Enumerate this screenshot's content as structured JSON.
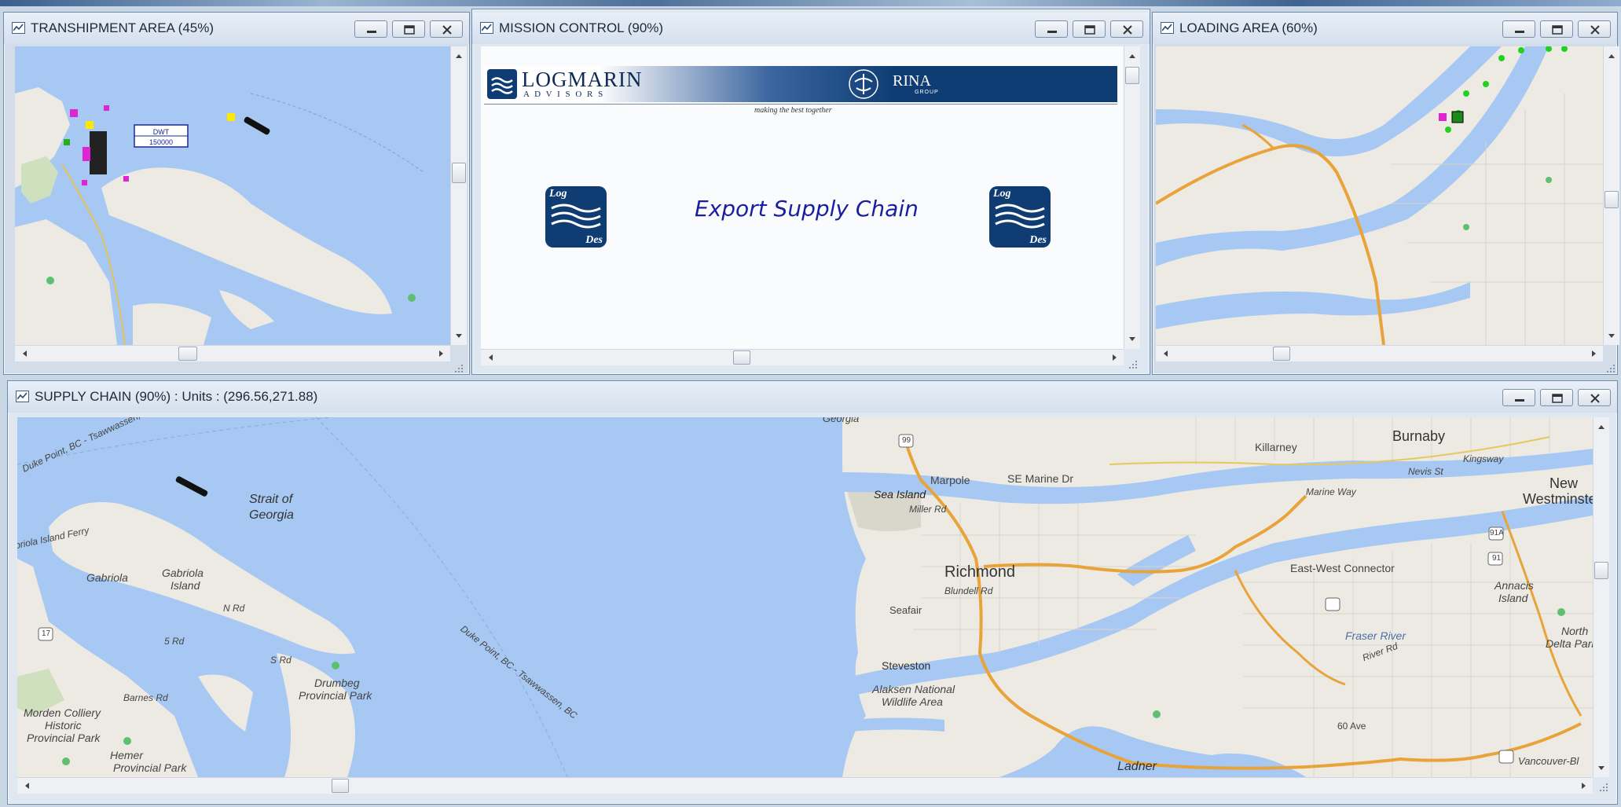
{
  "windows": {
    "transhipment": {
      "title": "TRANSHIPMENT AREA (45%)",
      "dwt_label": "DWT",
      "dwt_value": "150000"
    },
    "mission": {
      "title": "MISSION CONTROL (90%)",
      "heading": "Export Supply Chain"
    },
    "loading": {
      "title": "LOADING AREA (60%)"
    },
    "supply": {
      "title": "SUPPLY CHAIN (90%)  : Units : (296.56,271.88)"
    }
  },
  "mission_banner": {
    "logmarin_name": "LOGMARIN",
    "logmarin_sub": "A D V I S O R S",
    "rina_name": "RINA",
    "rina_sub": "GROUP",
    "tagline": "making the best together",
    "logo_top": "Log",
    "logo_bottom": "Des"
  },
  "supply_map_labels": {
    "strait": "Strait of",
    "strait2": "Georgia",
    "georgia_top": "Georgia",
    "ferry_top": "Duke Point, BC - Tsawwassen, BC",
    "ferry_bottom": "Duke Point, BC - Tsawwassen, BC",
    "island_ferry": "Gabriola Island Ferry",
    "gabriola": "Gabriola",
    "gabriola_island": "Gabriola",
    "gabriola_island2": "Island",
    "n_rd": "N Rd",
    "s_rd": "S Rd",
    "five_rd": "5 Rd",
    "drumbeg": "Drumbeg",
    "drumbeg2": "Provincial Park",
    "barnes": "Barnes Rd",
    "morden": "Morden Colliery",
    "morden2": "Historic",
    "morden3": "Provincial Park",
    "hemer": "Hemer",
    "hemer2": "Provincial Park",
    "sea_island": "Sea Island",
    "miller": "Miller Rd",
    "richmond": "Richmond",
    "blundell": "Blundell Rd",
    "seafair": "Seafair",
    "steveston": "Steveston",
    "alaksen": "Alaksen National",
    "alaksen2": "Wildlife Area",
    "ladner": "Ladner",
    "burnaby": "Burnaby",
    "killarney": "Killarney",
    "marpole": "Marpole",
    "se_marine": "SE Marine Dr",
    "marine_way": "Marine Way",
    "new_west": "New",
    "new_west2": "Westminste",
    "east_west": "East-West Connector",
    "annacis": "Annacis",
    "annacis2": "Island",
    "north_delta": "North",
    "north_delta2": "Delta Park",
    "fraser": "Fraser River",
    "river_rd": "River Rd",
    "ave60": "60 Ave",
    "vancouver_bl": "Vancouver-Bl",
    "hw99": "99",
    "hw91": "91",
    "hw91a": "91A",
    "hw17": "17",
    "nevis": "Nevis St",
    "kingsway": "Kingsway"
  },
  "colors": {
    "water": "#a7c8f2",
    "land": "#eceae3",
    "highway": "#e8a33a",
    "banner_blue": "#0e3c73",
    "heading_blue": "#1a1f9e"
  }
}
